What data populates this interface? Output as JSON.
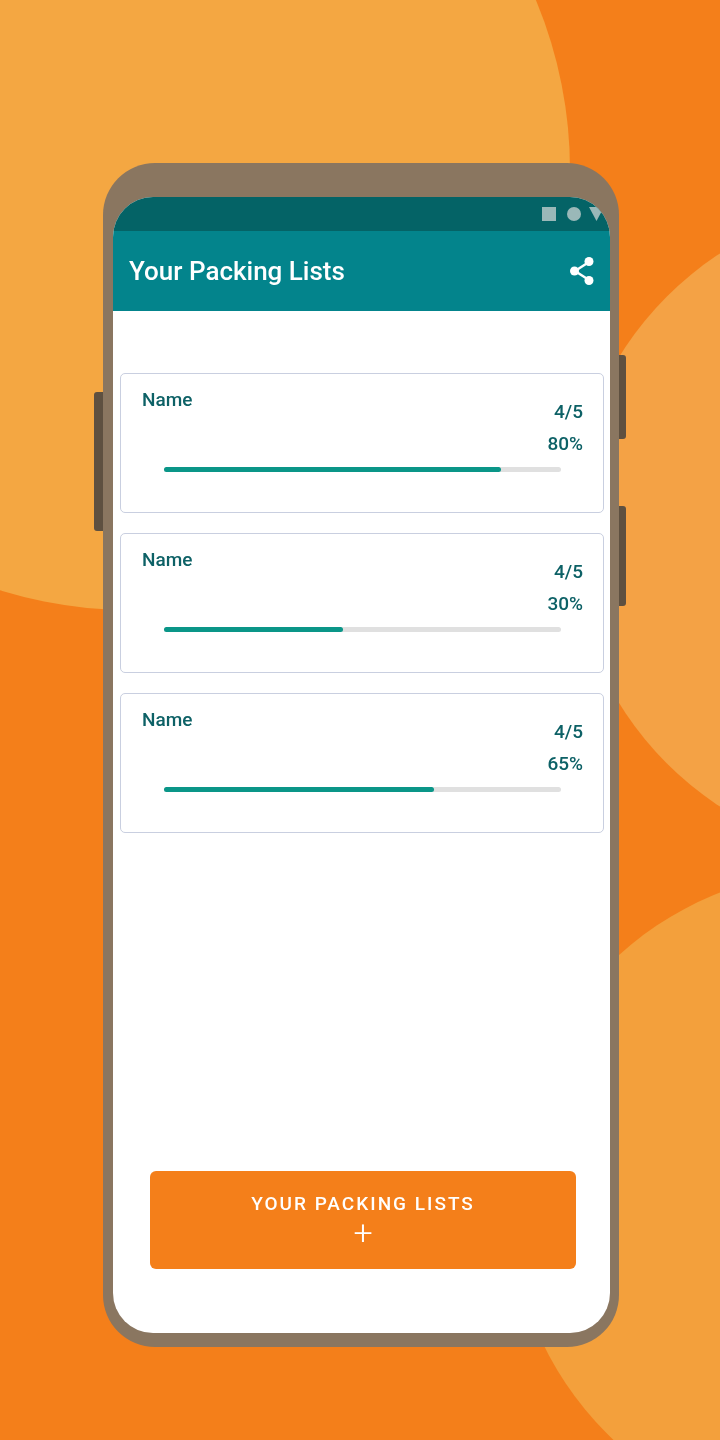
{
  "app_bar": {
    "title": "Your Packing Lists"
  },
  "lists": [
    {
      "name": "Name",
      "count": "4/5",
      "percent": "80%",
      "level": 0.85
    },
    {
      "name": "Name",
      "count": "4/5",
      "percent": "30%",
      "level": 0.45
    },
    {
      "name": "Name",
      "count": "4/5",
      "percent": "65%",
      "level": 0.68
    }
  ],
  "add_button": {
    "label": "YOUR PACKING LISTS",
    "icon": "+"
  }
}
